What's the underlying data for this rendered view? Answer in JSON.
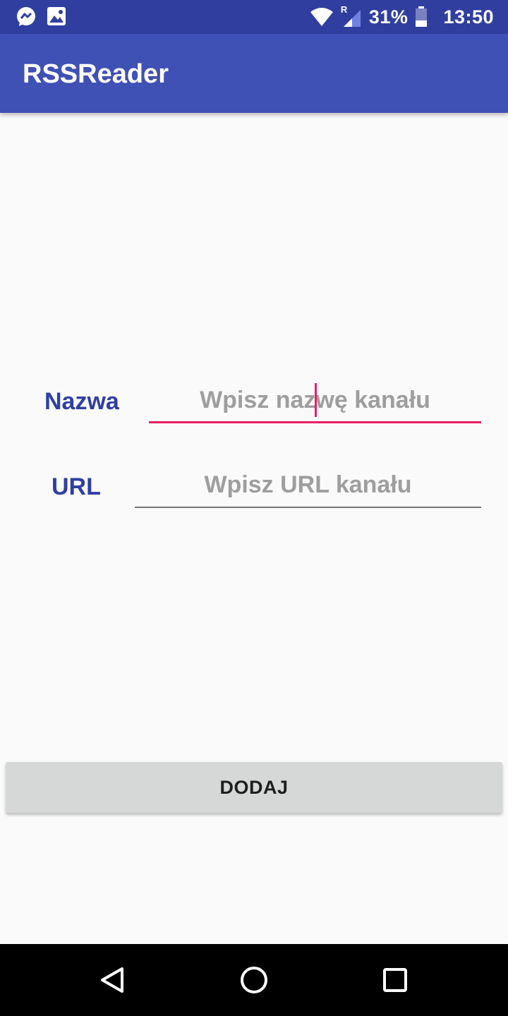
{
  "status_bar": {
    "battery": "31%",
    "time": "13:50",
    "roaming_indicator": "R",
    "icons": [
      "messenger-icon",
      "image-icon",
      "wifi-icon",
      "signal-icon",
      "battery-icon"
    ]
  },
  "app_bar": {
    "title": "RSSReader"
  },
  "form": {
    "name_label": "Nazwa",
    "name_placeholder": "Wpisz nazwę kanału",
    "name_value": "",
    "url_label": "URL",
    "url_placeholder": "Wpisz URL kanału",
    "url_value": ""
  },
  "add_button_label": "DODAJ",
  "nav_bar": {
    "icons": [
      "back-icon",
      "home-icon",
      "recents-icon"
    ]
  },
  "colors": {
    "status_bar": "#303f9f",
    "app_bar": "#3f51b5",
    "label": "#303f9f",
    "focus_accent": "#e91e63",
    "button_bg": "#d6d7d7"
  }
}
